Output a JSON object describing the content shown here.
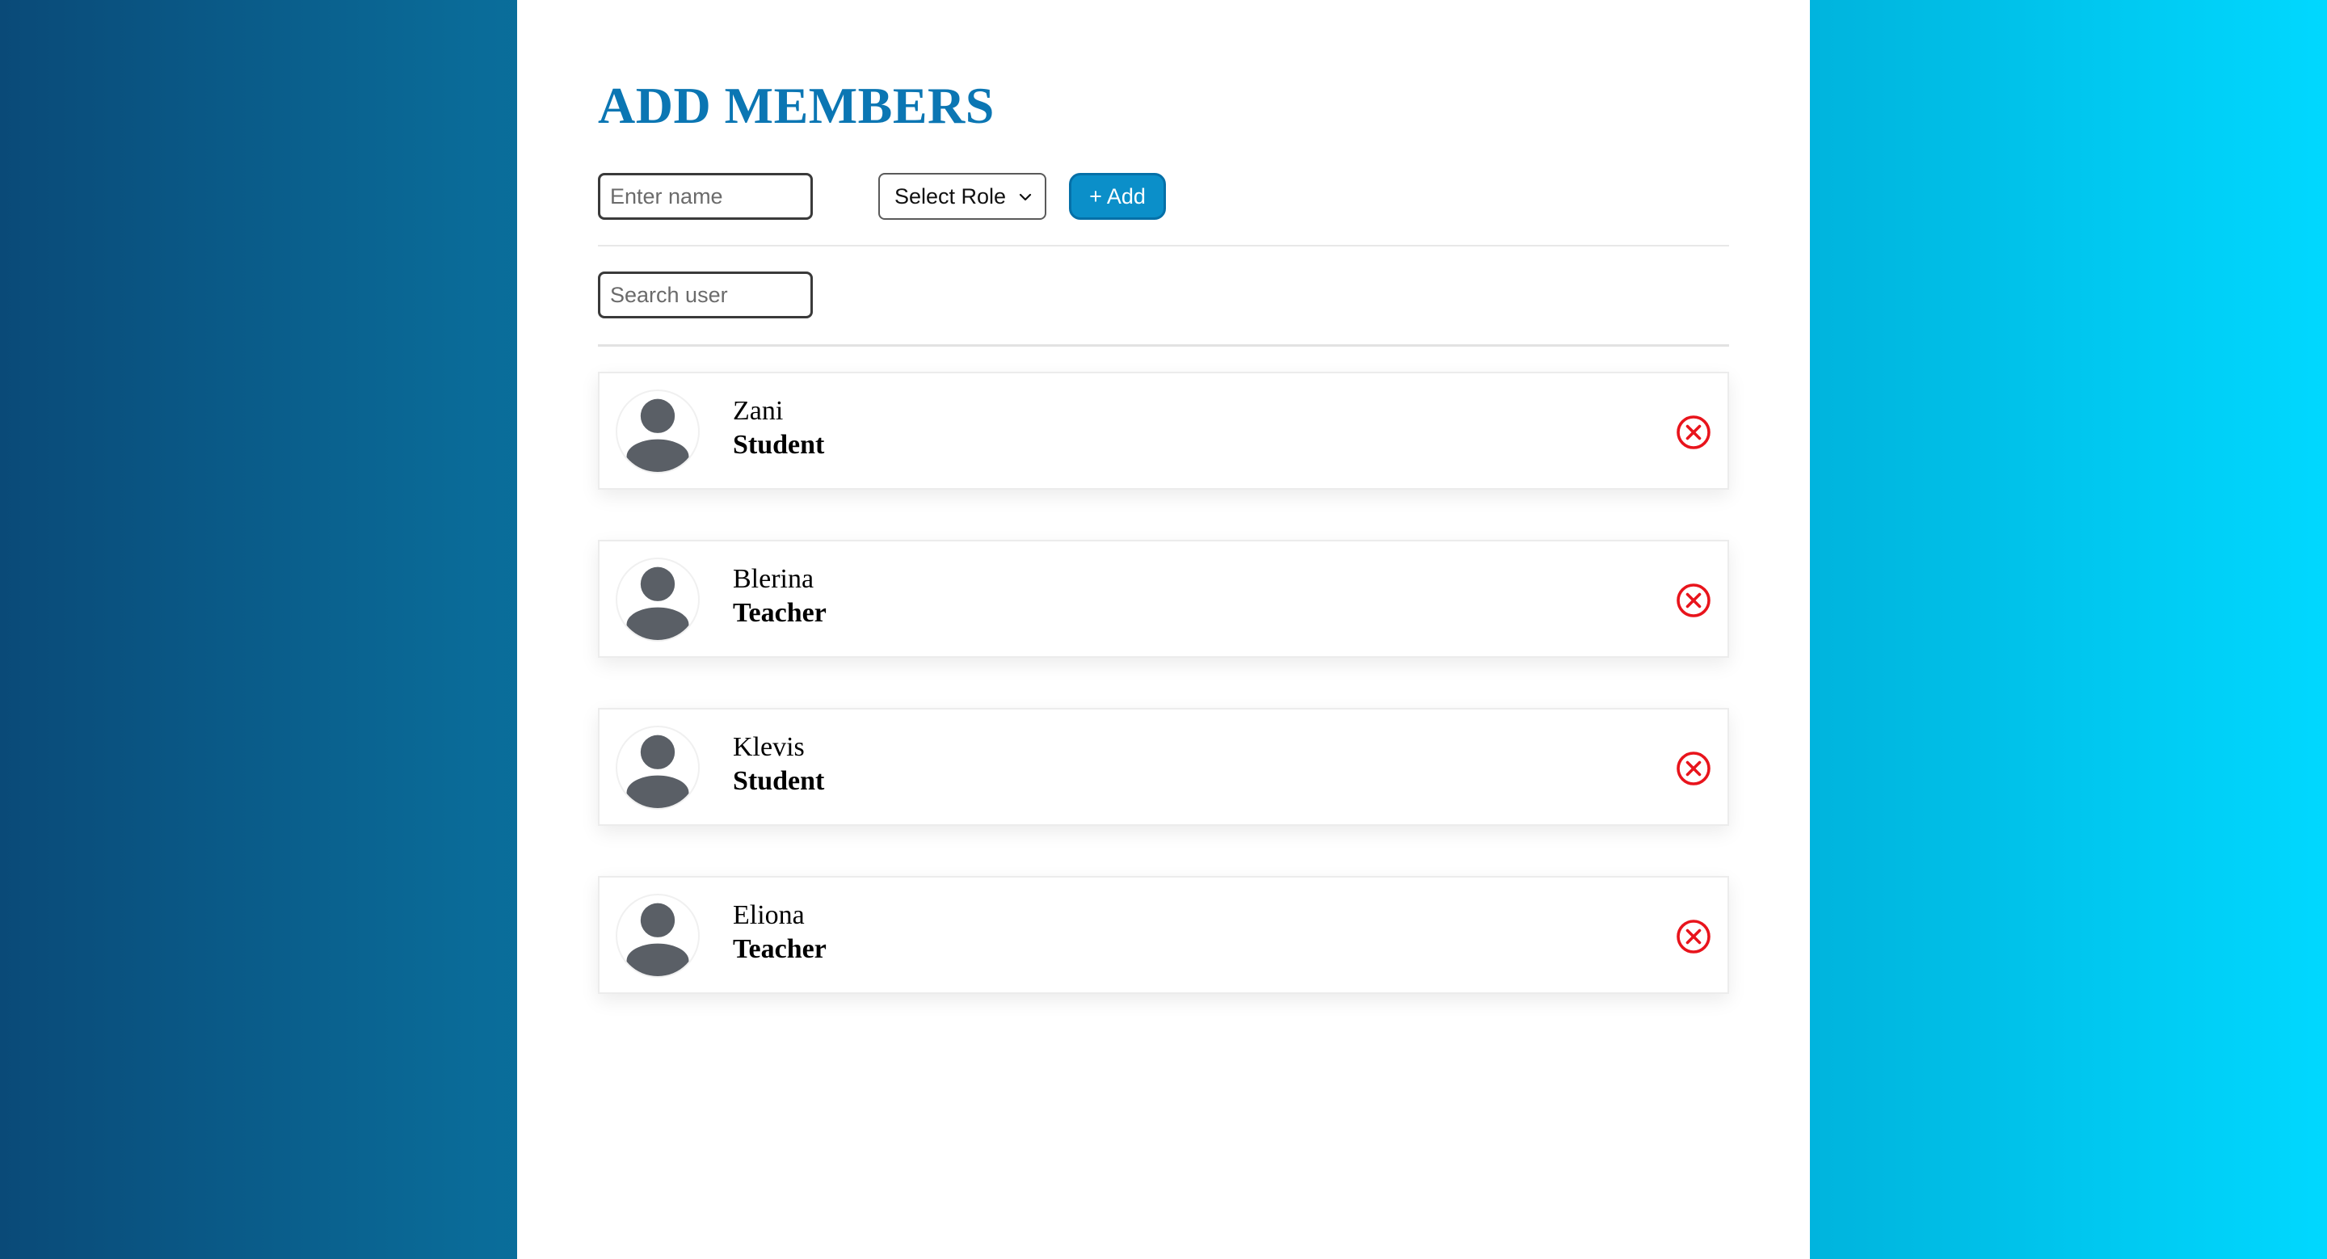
{
  "page": {
    "title": "ADD MEMBERS"
  },
  "add_form": {
    "name_placeholder": "Enter name",
    "name_value": "",
    "role_selected": "Select Role",
    "add_label": "+ Add"
  },
  "search": {
    "placeholder": "Search user",
    "value": ""
  },
  "members": [
    {
      "name": "Zani",
      "role": "Student"
    },
    {
      "name": "Blerina",
      "role": "Teacher"
    },
    {
      "name": "Klevis",
      "role": "Student"
    },
    {
      "name": "Eliona",
      "role": "Teacher"
    }
  ],
  "icons": {
    "avatar": "user-avatar-icon",
    "remove": "close-circle-icon",
    "select_chevron": "chevron-down-icon"
  },
  "colors": {
    "title": "#0b76b3",
    "add_button": "#0b8fc9",
    "remove_icon": "#e8141c",
    "avatar_fill": "#5a5f66",
    "background_left": "#0a4a78",
    "background_right": "#00d8ff"
  }
}
